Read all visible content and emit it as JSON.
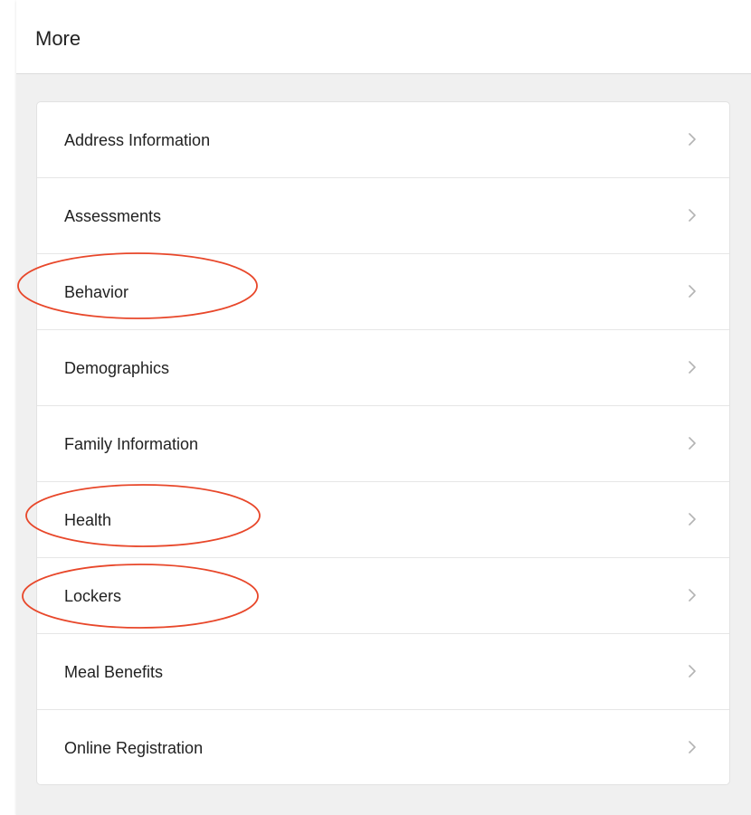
{
  "header": {
    "title": "More"
  },
  "menu": {
    "items": [
      {
        "label": "Address Information"
      },
      {
        "label": "Assessments"
      },
      {
        "label": "Behavior"
      },
      {
        "label": "Demographics"
      },
      {
        "label": "Family Information"
      },
      {
        "label": "Health"
      },
      {
        "label": "Lockers"
      },
      {
        "label": "Meal Benefits"
      },
      {
        "label": "Online Registration"
      }
    ]
  },
  "icons": {
    "row_icon": "chevron-right-icon"
  },
  "colors": {
    "background": "#f0f0f0",
    "card": "#ffffff",
    "divider": "#e6e6e6",
    "text": "#222222",
    "chevron": "#b3b3b3",
    "annotation": "#e8472a"
  }
}
